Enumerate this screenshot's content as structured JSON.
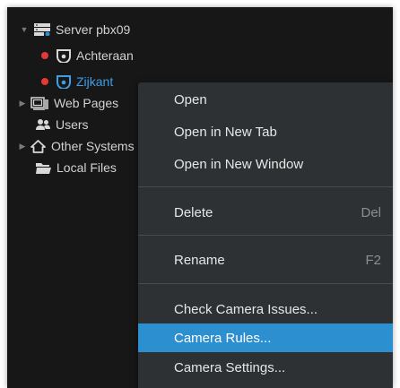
{
  "tree": {
    "server": {
      "label": "Server pbx09",
      "icon": "server-icon"
    },
    "cameras": [
      {
        "label": "Achteraan",
        "icon": "camera-icon",
        "status_color": "#e53935"
      },
      {
        "label": "Zijkant",
        "icon": "camera-icon",
        "status_color": "#e53935",
        "selected": true
      }
    ],
    "web_pages": {
      "label": "Web Pages",
      "icon": "web-page-icon"
    },
    "users": {
      "label": "Users",
      "icon": "users-icon"
    },
    "other_systems": {
      "label": "Other Systems",
      "icon": "home-icon"
    },
    "local_files": {
      "label": "Local Files",
      "icon": "folder-icon"
    }
  },
  "context_menu": {
    "items": [
      {
        "label": "Open",
        "shortcut": ""
      },
      {
        "label": "Open in New Tab",
        "shortcut": ""
      },
      {
        "label": "Open in New Window",
        "shortcut": ""
      },
      {
        "label": "Delete",
        "shortcut": "Del"
      },
      {
        "label": "Rename",
        "shortcut": "F2"
      },
      {
        "label": "Check Camera Issues...",
        "shortcut": ""
      },
      {
        "label": "Camera Rules...",
        "shortcut": "",
        "highlighted": true
      },
      {
        "label": "Camera Settings...",
        "shortcut": ""
      }
    ]
  },
  "colors": {
    "background": "#171717",
    "menu_background": "#2d3133",
    "highlight": "#2b8fd0",
    "selected_text": "#3e9ee6",
    "status_offline": "#e53935"
  }
}
